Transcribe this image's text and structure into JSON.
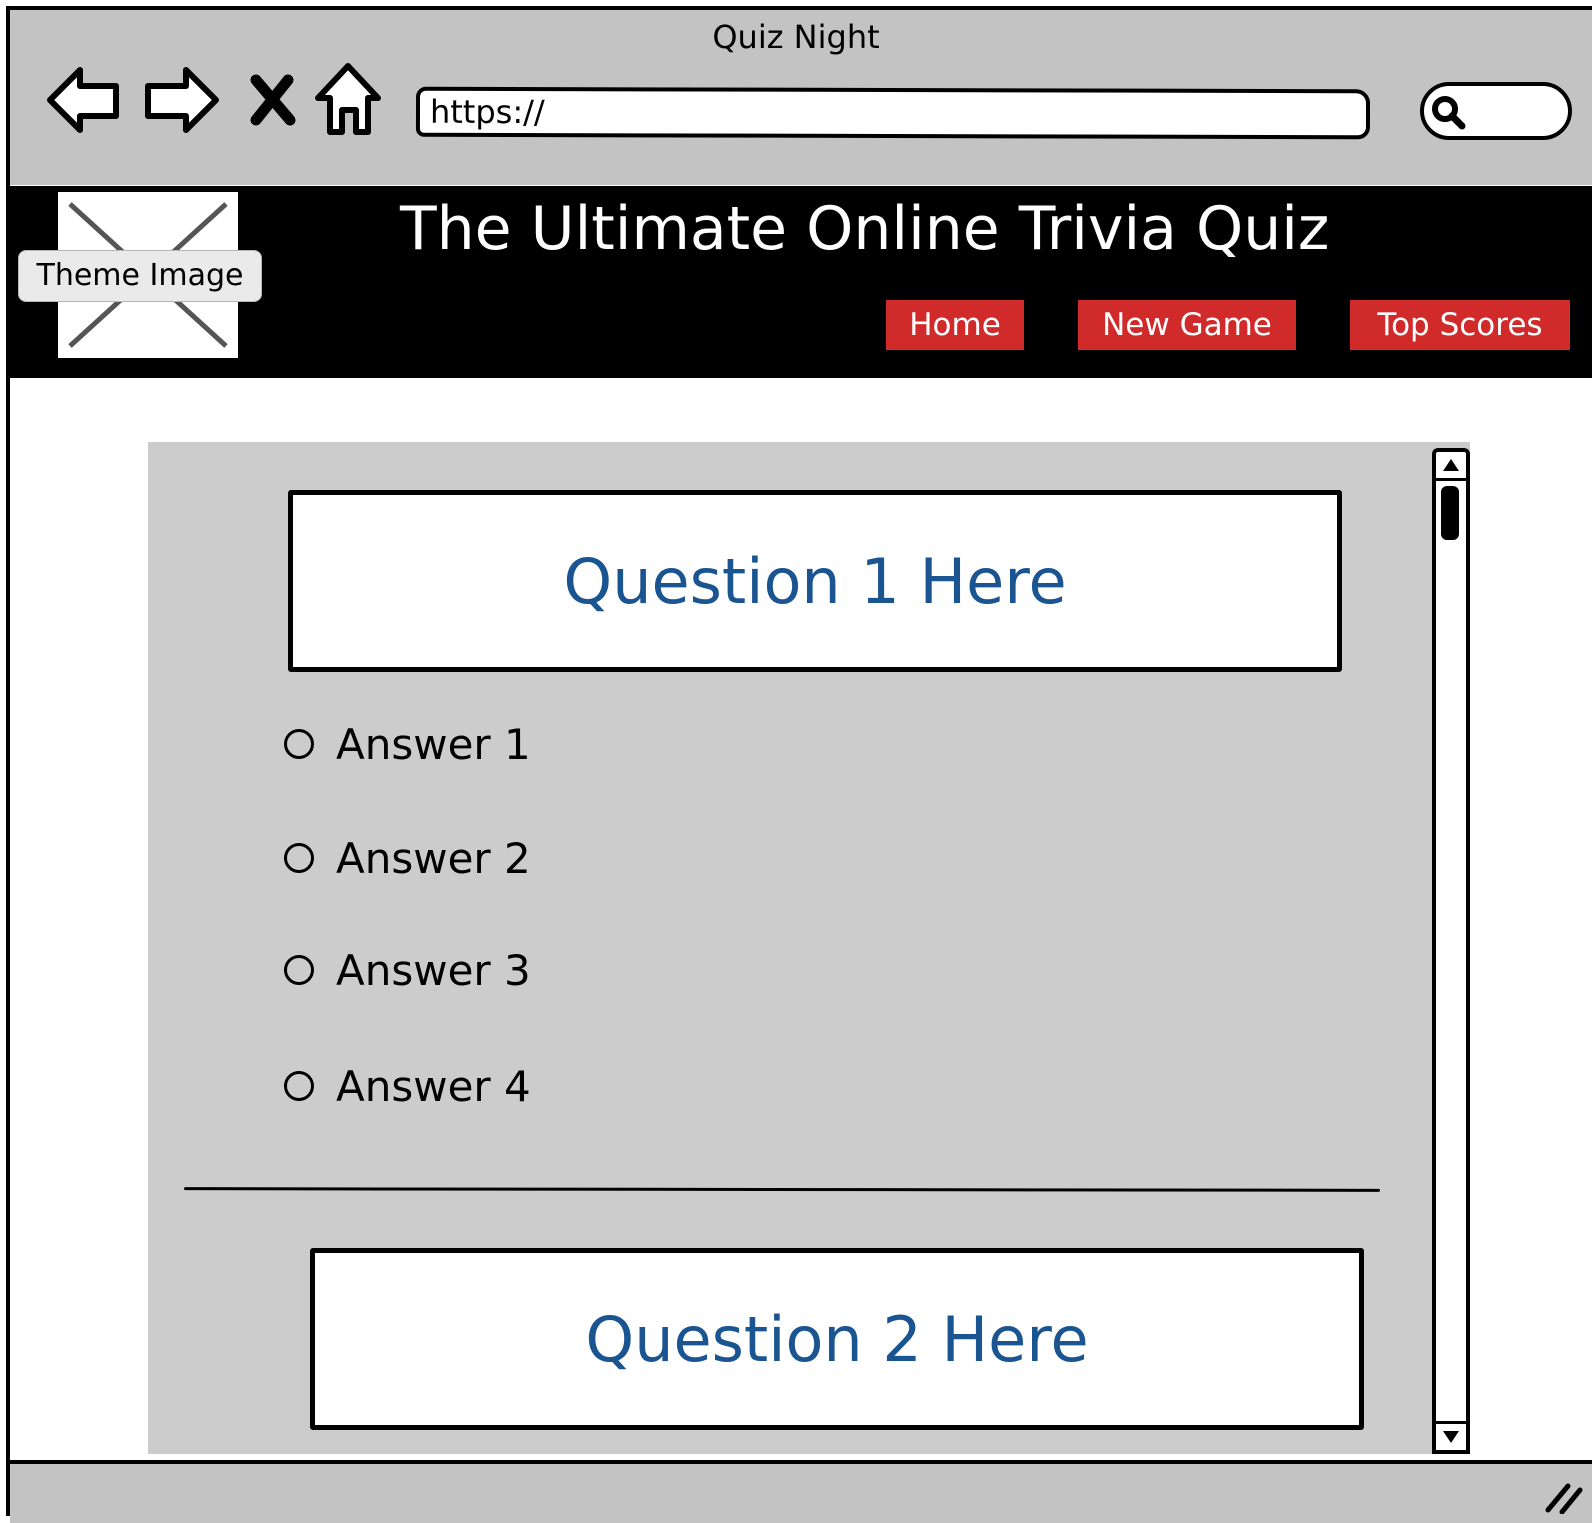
{
  "browser": {
    "window_title": "Quiz Night",
    "url": "https://"
  },
  "header": {
    "image_label": "Theme Image",
    "title": "The Ultimate Online Trivia Quiz",
    "nav": {
      "home": "Home",
      "new_game": "New Game",
      "top_scores": "Top Scores"
    }
  },
  "quiz": {
    "question1": {
      "text": "Question 1 Here",
      "answers": [
        "Answer 1",
        "Answer 2",
        "Answer 3",
        "Answer 4"
      ]
    },
    "question2": {
      "text": "Question 2 Here"
    }
  },
  "colors": {
    "nav_button": "#d12a2a",
    "question_text": "#1a5591",
    "panel_bg": "#cccccc",
    "chrome_bg": "#c3c3c3"
  }
}
